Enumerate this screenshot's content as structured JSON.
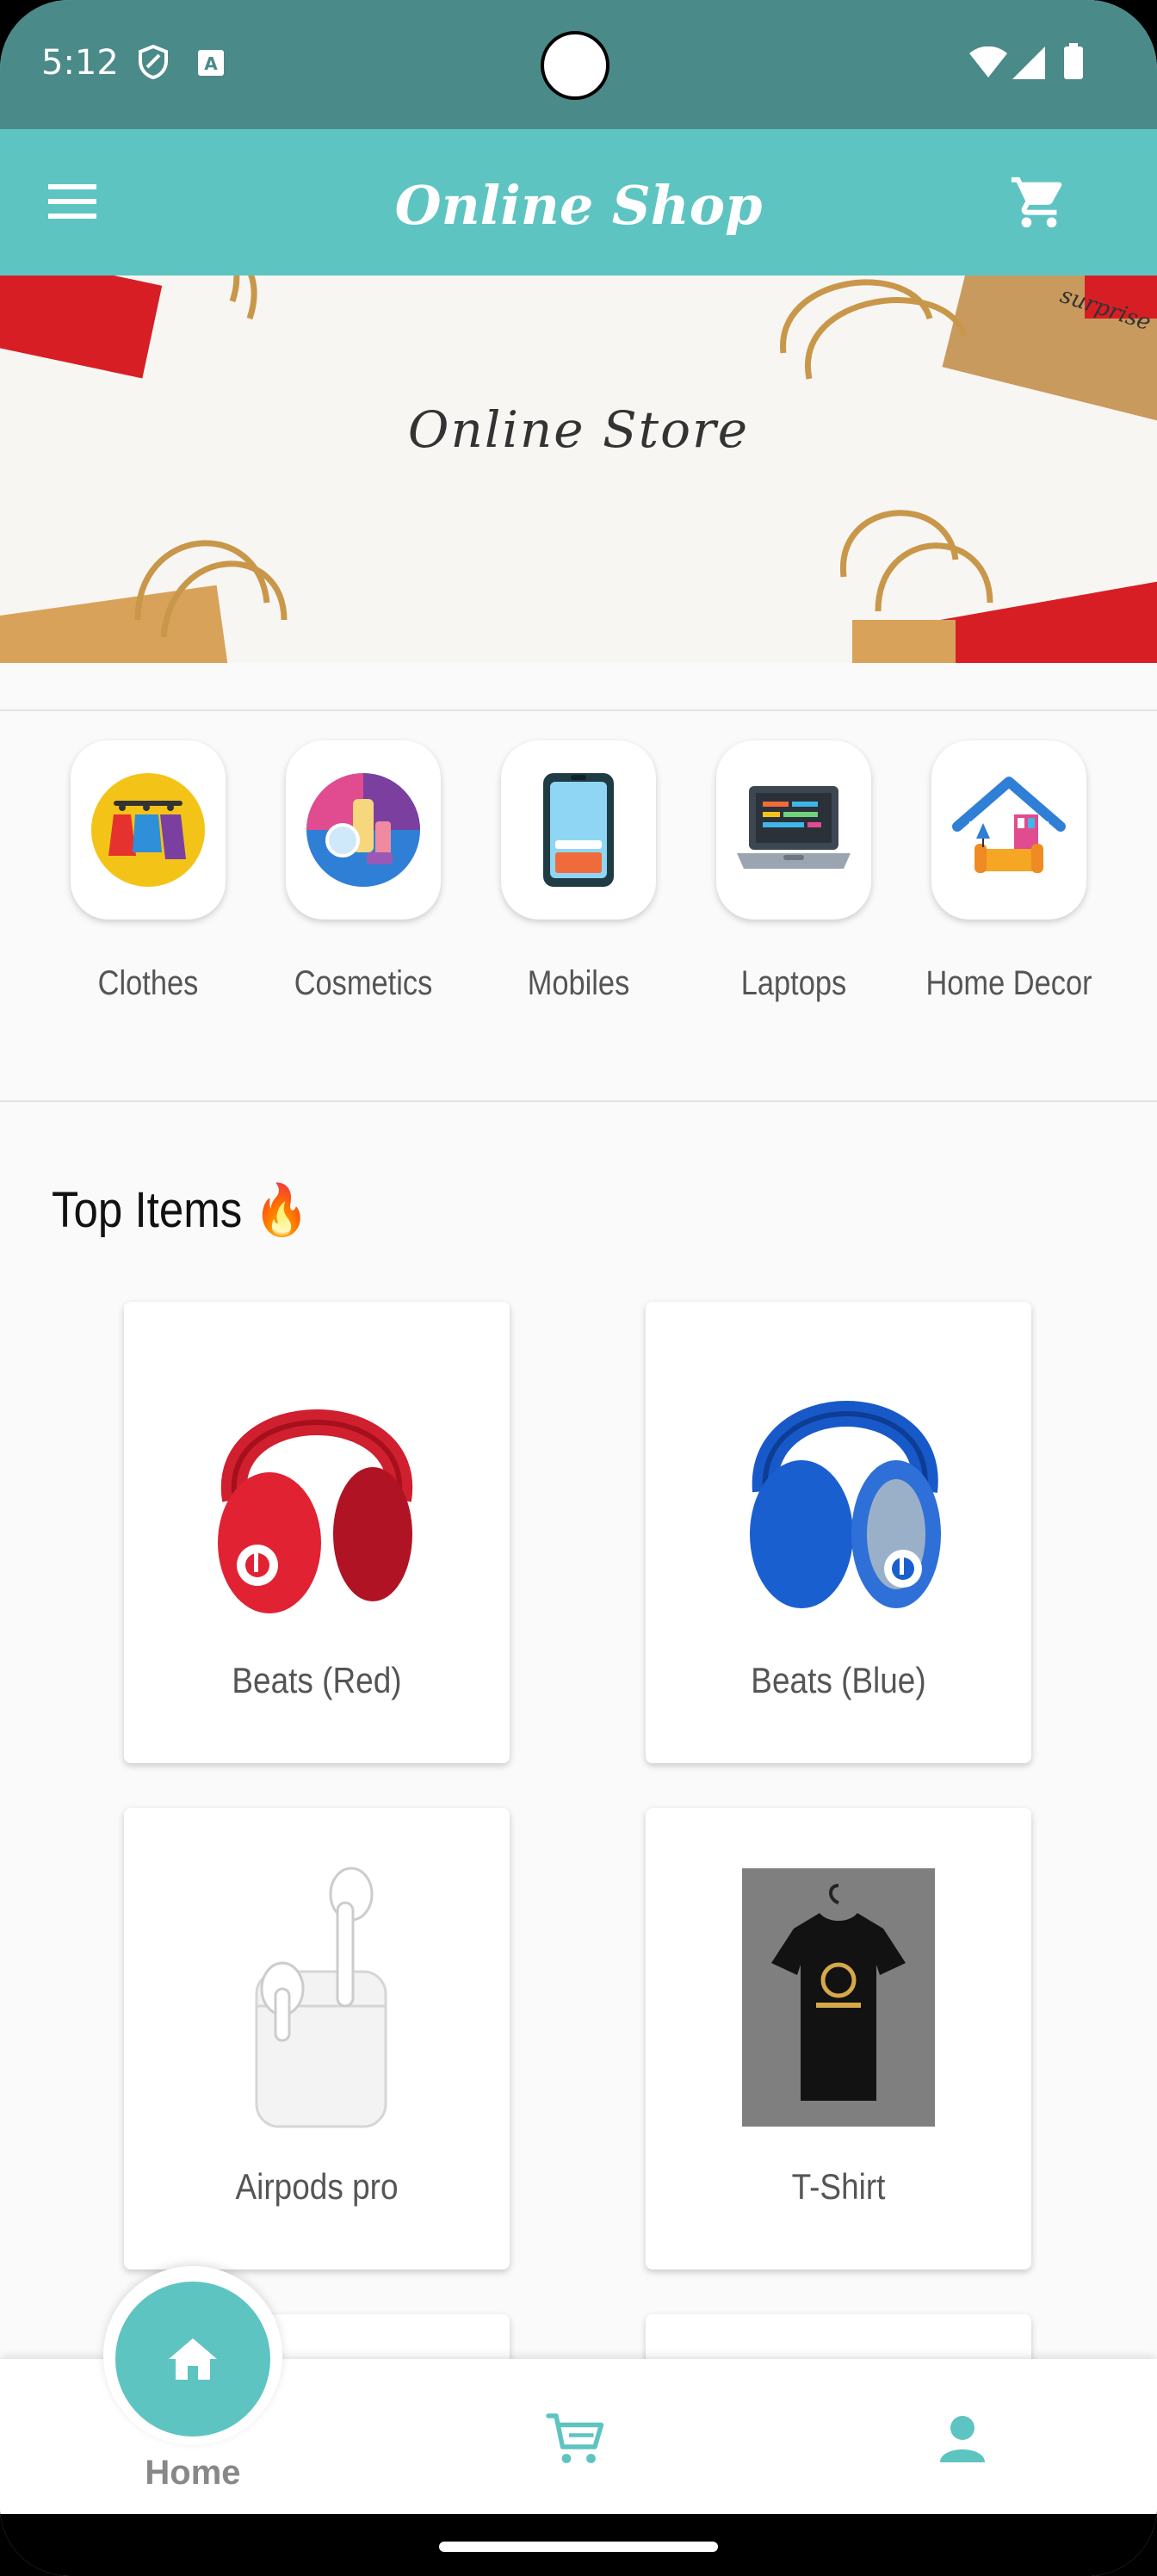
{
  "status_bar": {
    "time": "5:12"
  },
  "app_bar": {
    "title": "Online Shop",
    "menu_icon": "menu-icon",
    "cart_icon": "cart-icon"
  },
  "banner": {
    "text": "Online Store"
  },
  "categories": [
    {
      "label": "Clothes",
      "icon": "clothes-icon"
    },
    {
      "label": "Cosmetics",
      "icon": "cosmetics-icon"
    },
    {
      "label": "Mobiles",
      "icon": "mobile-icon"
    },
    {
      "label": "Laptops",
      "icon": "laptop-icon"
    },
    {
      "label": "Home Decor",
      "icon": "home-decor-icon"
    }
  ],
  "top_items": {
    "title": "Top Items 🔥",
    "items": [
      {
        "label": "Beats (Red)"
      },
      {
        "label": "Beats (Blue)"
      },
      {
        "label": "Airpods pro"
      },
      {
        "label": "T-Shirt"
      }
    ]
  },
  "bottom_nav": {
    "home_label": "Home",
    "items": [
      "home-icon",
      "cart-icon",
      "profile-icon"
    ]
  },
  "colors": {
    "accent": "#5ec4c1",
    "status_bar": "#4a8a89"
  }
}
